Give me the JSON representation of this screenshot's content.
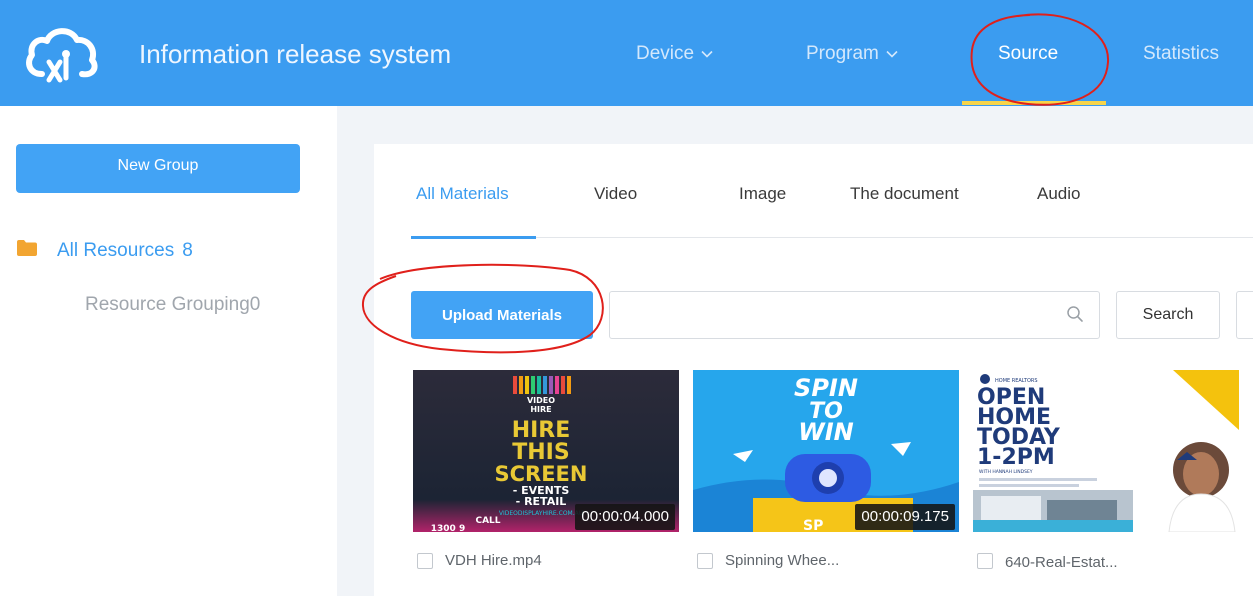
{
  "header": {
    "app_title": "Information release system",
    "nav": [
      {
        "label": "Device",
        "has_dropdown": true
      },
      {
        "label": "Program",
        "has_dropdown": true
      },
      {
        "label": "Source",
        "active": true
      },
      {
        "label": "Statistics"
      }
    ],
    "colors": {
      "bar": "#3b9cf0",
      "active_underline": "#f7d44a"
    }
  },
  "sidebar": {
    "new_group_label": "New Group",
    "all_resources": {
      "label": "All Resources",
      "count": "8"
    },
    "resource_grouping_label": "Resource Grouping0"
  },
  "main": {
    "tabs": [
      {
        "label": "All Materials",
        "active": true
      },
      {
        "label": "Video"
      },
      {
        "label": "Image"
      },
      {
        "label": "The document"
      },
      {
        "label": "Audio"
      }
    ],
    "upload_label": "Upload Materials",
    "search": {
      "value": "",
      "placeholder": "",
      "button_label": "Search"
    },
    "materials": [
      {
        "name": "VDH Hire.mp4",
        "duration": "00:00:04.000",
        "thumb": {
          "logo_line1": "VIDEO",
          "logo_line2": "HIRE",
          "line1": "HIRE",
          "line2": "THIS",
          "line3": "SCREEN",
          "line4": "- EVENTS",
          "line5": "- RETAIL",
          "line6": "VIDEODISPLAYHIRE.COM.AU",
          "line7": "CALL",
          "line8": "1300 9"
        }
      },
      {
        "name": "Spinning Whee...",
        "duration": "00:00:09.175",
        "thumb": {
          "line1": "SPIN",
          "line2": "TO",
          "line3": "WIN",
          "line4": "SP"
        }
      },
      {
        "name": "640-Real-Estat...",
        "duration": "",
        "thumb": {
          "header": "HOME REALTORS",
          "line1": "OPEN",
          "line2": "HOME",
          "line3": "TODAY",
          "line4": "1-2PM",
          "line5": "WITH HANNAH LINDSEY"
        }
      }
    ]
  },
  "accent_color": "#3b9cf0",
  "annotation_color": "#e0201b"
}
